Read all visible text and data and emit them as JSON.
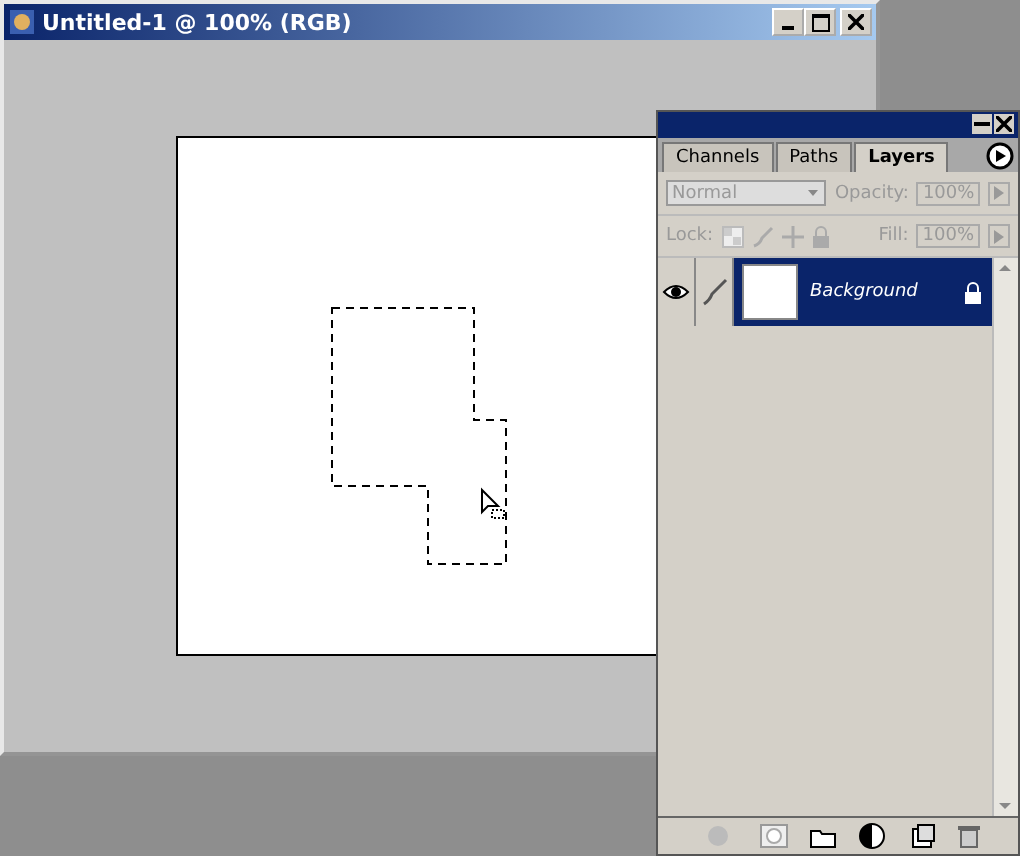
{
  "document": {
    "title": "Untitled-1 @ 100% (RGB)"
  },
  "layers_panel": {
    "tabs": [
      {
        "label": "Channels",
        "selected": false
      },
      {
        "label": "Paths",
        "selected": false
      },
      {
        "label": "Layers",
        "selected": true
      }
    ],
    "blend_mode": {
      "value": "Normal",
      "disabled": true
    },
    "opacity_label": "Opacity:",
    "opacity": "100%",
    "lock_label": "Lock:",
    "fill_label": "Fill:",
    "fill": "100%",
    "layers": [
      {
        "name": "Background",
        "visible": true,
        "selected": true,
        "locked": true
      }
    ]
  }
}
